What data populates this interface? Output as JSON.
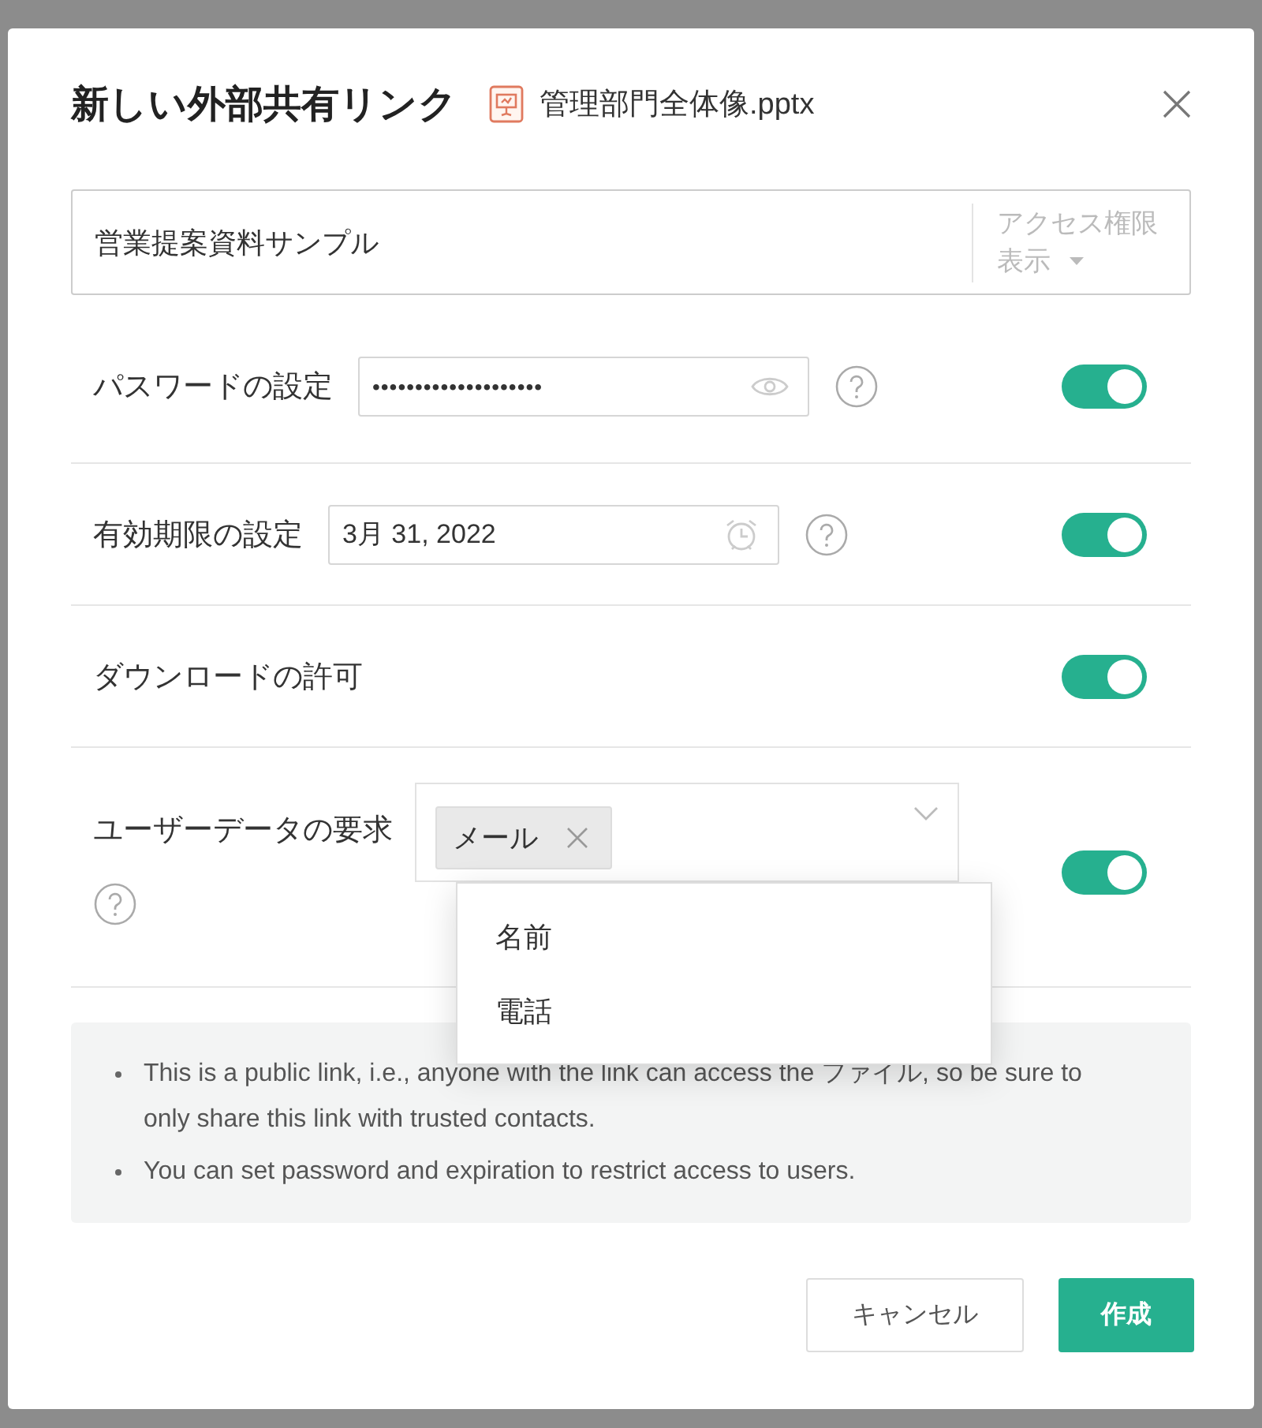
{
  "dialog": {
    "title": "新しい外部共有リンク",
    "file_name": "管理部門全体像.pptx"
  },
  "link_name": {
    "value": "営業提案資料サンプル",
    "access_label": "アクセス権限",
    "access_value": "表示"
  },
  "settings": [
    {
      "kind": "password",
      "label": "パスワードの設定",
      "value": "••••••••••••••••••••",
      "on": true
    },
    {
      "kind": "date",
      "label": "有効期限の設定",
      "value": "3月 31, 2022",
      "on": true
    },
    {
      "kind": "plain",
      "label": "ダウンロードの許可",
      "on": true
    },
    {
      "kind": "multiselect",
      "label": "ユーザーデータの要求",
      "tags": [
        "メール"
      ],
      "options": [
        "名前",
        "電話"
      ],
      "expanded": true,
      "on": true
    }
  ],
  "notes": [
    "This is a public link, i.e., anyone with the link can access the ファイル, so be sure to only share this link with trusted contacts.",
    "You can set password and expiration to restrict access to users."
  ],
  "buttons": [
    {
      "label": "キャンセル",
      "kind": "secondary"
    },
    {
      "label": "作成",
      "kind": "primary"
    }
  ]
}
